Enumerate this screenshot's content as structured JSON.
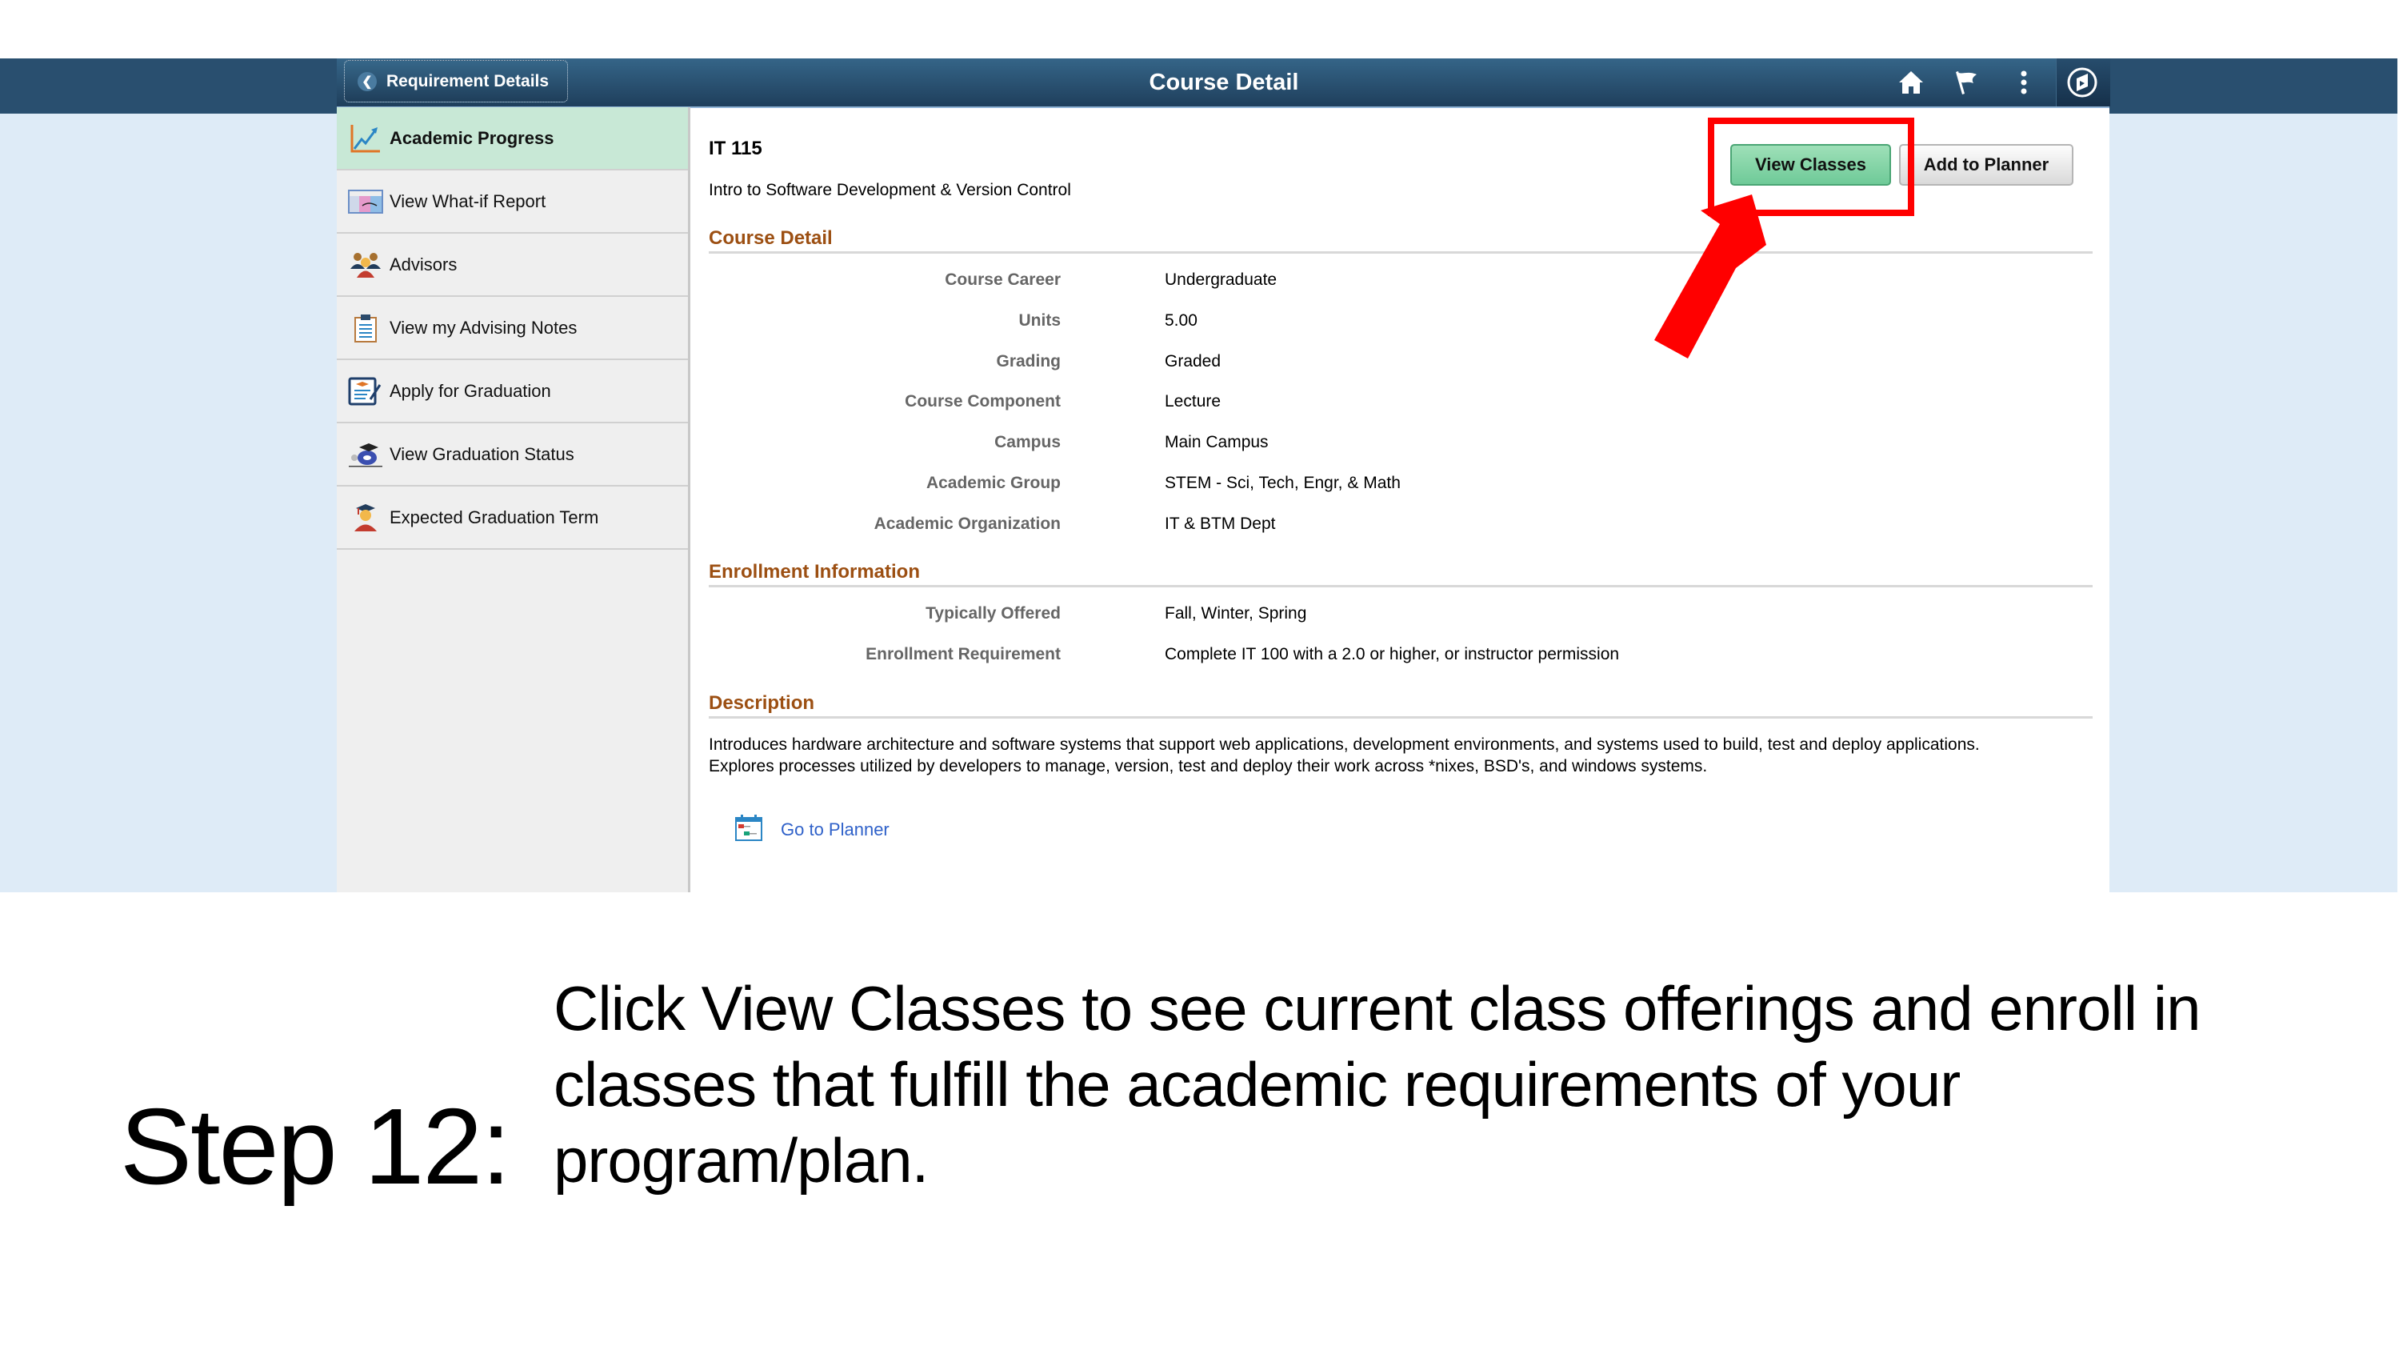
{
  "header": {
    "back_label": "Requirement Details",
    "title": "Course Detail",
    "icons": [
      "home-icon",
      "flag-icon",
      "more-icon",
      "navbar-compass-icon"
    ]
  },
  "sidebar": {
    "items": [
      {
        "label": "Academic Progress",
        "icon": "chart-icon",
        "active": true
      },
      {
        "label": "View What-if Report",
        "icon": "what-if-report-icon",
        "active": false
      },
      {
        "label": "Advisors",
        "icon": "advisors-icon",
        "active": false
      },
      {
        "label": "View my Advising Notes",
        "icon": "clipboard-icon",
        "active": false
      },
      {
        "label": "Apply for Graduation",
        "icon": "graduation-application-icon",
        "active": false
      },
      {
        "label": "View Graduation Status",
        "icon": "graduation-status-icon",
        "active": false
      },
      {
        "label": "Expected Graduation Term",
        "icon": "graduate-icon",
        "active": false
      }
    ]
  },
  "course": {
    "code": "IT 115",
    "title": "Intro to Software Development & Version Control"
  },
  "buttons": {
    "view_classes": "View Classes",
    "add_to_planner": "Add to Planner"
  },
  "sections": {
    "course_detail": {
      "title": "Course Detail",
      "rows": [
        {
          "label": "Course Career",
          "value": "Undergraduate"
        },
        {
          "label": "Units",
          "value": "5.00"
        },
        {
          "label": "Grading",
          "value": "Graded"
        },
        {
          "label": "Course Component",
          "value": "Lecture"
        },
        {
          "label": "Campus",
          "value": "Main Campus"
        },
        {
          "label": "Academic Group",
          "value": "STEM - Sci, Tech, Engr, & Math"
        },
        {
          "label": "Academic Organization",
          "value": "IT & BTM Dept"
        }
      ]
    },
    "enrollment": {
      "title": "Enrollment Information",
      "rows": [
        {
          "label": "Typically Offered",
          "value": "Fall, Winter, Spring"
        },
        {
          "label": "Enrollment Requirement",
          "value": "Complete IT 100 with a 2.0 or higher, or instructor permission"
        }
      ]
    },
    "description": {
      "title": "Description",
      "text_line1": "Introduces hardware architecture and software systems that support web applications, development environments, and systems used to build, test and deploy applications.",
      "text_line2": "Explores processes utilized by developers to manage, version, test and deploy their work across *nixes, BSD's, and windows systems."
    }
  },
  "planner_link": "Go to Planner",
  "annotation": {
    "color": "#ff0000",
    "target": "View Classes"
  },
  "instruction": {
    "step": "Step 12:",
    "prefix": "Click ",
    "emphasis": "View Classes",
    "suffix": " to see current class offerings and enroll in classes that fulfill the academic requirements of your program/plan."
  },
  "colors": {
    "header": "#294f6f",
    "band": "#deebf7",
    "active_item": "#c8e8d6",
    "section_title": "#9c4f12",
    "link": "#2f61c9",
    "primary_button": "#6fca98"
  }
}
